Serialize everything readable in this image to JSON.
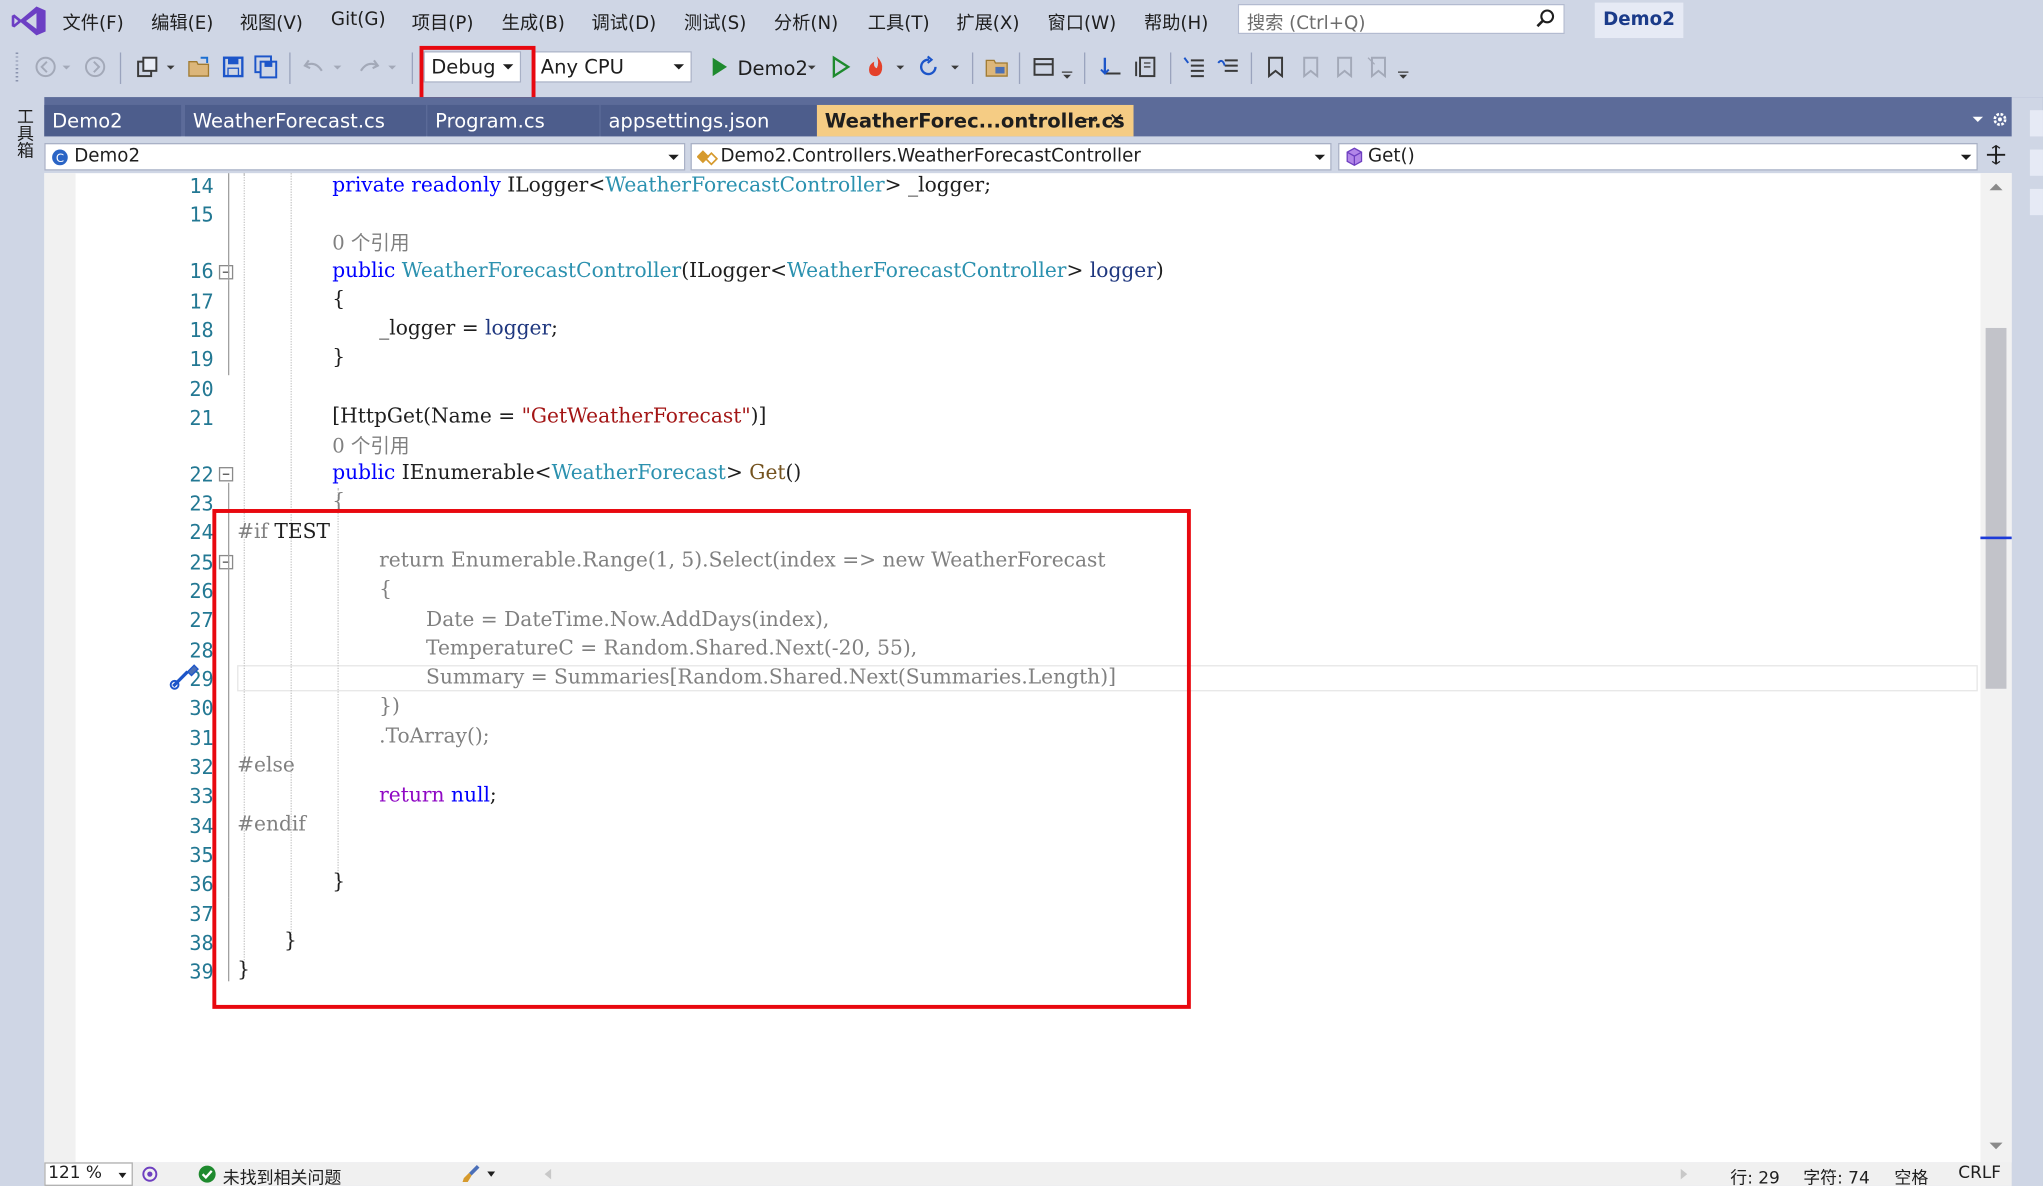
{
  "menu": {
    "items": [
      "文件(F)",
      "编辑(E)",
      "视图(V)",
      "Git(G)",
      "项目(P)",
      "生成(B)",
      "调试(D)",
      "测试(S)",
      "分析(N)",
      "工具(T)",
      "扩展(X)",
      "窗口(W)",
      "帮助(H)"
    ],
    "search_placeholder": "搜索 (Ctrl+Q)",
    "solution_name": "Demo2"
  },
  "toolbar": {
    "configuration": "Debug",
    "platform": "Any CPU",
    "startup_project": "Demo2"
  },
  "toolbox_label": "工具箱",
  "tabs": [
    {
      "label": "Demo2",
      "active": false
    },
    {
      "label": "WeatherForecast.cs",
      "active": false
    },
    {
      "label": "Program.cs",
      "active": false
    },
    {
      "label": "appsettings.json",
      "active": false
    },
    {
      "label": "WeatherForec...ontroller.cs",
      "active": true
    }
  ],
  "tab_glyphs": {
    "pin": "⊸",
    "close": "✕"
  },
  "navbar": {
    "project": "Demo2",
    "type": "Demo2.Controllers.WeatherForecastController",
    "member": "Get()"
  },
  "editor": {
    "line_numbers": [
      "14",
      "15",
      "16",
      "17",
      "18",
      "19",
      "20",
      "21",
      "22",
      "23",
      "24",
      "25",
      "26",
      "27",
      "28",
      "29",
      "30",
      "31",
      "32",
      "33",
      "34",
      "35",
      "36",
      "37",
      "38",
      "39"
    ],
    "references": [
      "0 个引用",
      "0 个引用"
    ],
    "code": {
      "l14": {
        "kw1": "private",
        "kw2": "readonly",
        "t1": "ILogger",
        "lt": "<",
        "t2": "WeatherForecastController",
        "gt": ">",
        "rest": " _logger;"
      },
      "l16": {
        "kw": "public",
        "ctor": "WeatherForecastController",
        "p1": "(",
        "t1": "ILogger",
        "lt": "<",
        "t2": "WeatherForecastController",
        "gt": ">",
        "param": "logger",
        "p2": ")"
      },
      "l17": "{",
      "l18": {
        "field": "_logger",
        "eq": " = ",
        "param": "logger",
        "semi": ";"
      },
      "l19": "}",
      "l21": {
        "open": "[",
        "attr": "HttpGet",
        "mid": "(Name = ",
        "str": "\"GetWeatherForecast\"",
        "close": ")]"
      },
      "l22": {
        "kw": "public",
        "t1": "IEnumerable",
        "lt": "<",
        "t2": "WeatherForecast",
        "gt": ">",
        "method": "Get",
        "paren": "()"
      },
      "l23": "{",
      "l24": {
        "directive": "#if",
        "symbol": "TEST"
      },
      "l25": "return Enumerable.Range(1, 5).Select(index => new WeatherForecast",
      "l26": "{",
      "l27": "Date = DateTime.Now.AddDays(index),",
      "l28": "TemperatureC = Random.Shared.Next(-20, 55),",
      "l29": "Summary = Summaries[Random.Shared.Next(Summaries.Length)]",
      "l30": "})",
      "l31": ".ToArray();",
      "l32": "#else",
      "l33": {
        "kw": "return",
        "null": "null",
        "semi": ";"
      },
      "l34": "#endif",
      "l36": "}",
      "l38": "}",
      "l39": "}"
    }
  },
  "status": {
    "zoom": "121 %",
    "issues": "未找到相关问题",
    "line": "行: 29",
    "char": "字符: 74",
    "whitespace": "空格",
    "line_ending": "CRLF"
  },
  "colors": {
    "highlight_red": "#e8080f",
    "active_tab": "#f5cc84",
    "tab_bar": "#5c6b99",
    "keyword": "#0000ff",
    "type": "#2b91af",
    "string": "#a31515",
    "line_number": "#237893",
    "chrome": "#cfd6e5"
  }
}
